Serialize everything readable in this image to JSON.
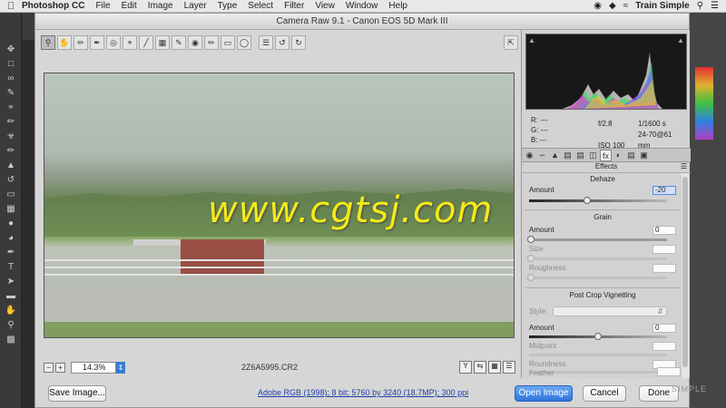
{
  "menubar": {
    "app_name": "Photoshop CC",
    "items": [
      "File",
      "Edit",
      "Image",
      "Layer",
      "Type",
      "Select",
      "Filter",
      "View",
      "Window",
      "Help"
    ],
    "user": "Train Simple"
  },
  "dialog": {
    "title": "Camera Raw 9.1  -  Canon EOS 5D Mark III",
    "zoom": "14.3%",
    "filename": "2Z6A5995.CR2",
    "workflow": "Adobe RGB (1998); 8 bit; 5760 by 3240 (18.7MP); 300 ppi",
    "buttons": {
      "save": "Save Image...",
      "open": "Open Image",
      "cancel": "Cancel",
      "done": "Done"
    }
  },
  "watermark": "www.cgtsj.com",
  "info": {
    "r": "R:   ---",
    "g": "G:   ---",
    "b": "B:   ---",
    "aperture": "f/2.8",
    "shutter": "1/1600 s",
    "iso": "ISO 100",
    "lens": "24-70@61 mm"
  },
  "panel": {
    "title": "Effects",
    "dehaze": {
      "heading": "Dehaze",
      "amount_label": "Amount",
      "amount": "-20",
      "amount_level": -20
    },
    "grain": {
      "heading": "Grain",
      "amount_label": "Amount",
      "amount": "0",
      "size_label": "Size",
      "roughness_label": "Roughness"
    },
    "vignette": {
      "heading": "Post Crop Vignetting",
      "style_label": "Style:",
      "amount_label": "Amount",
      "amount": "0",
      "midpoint_label": "Midpoint",
      "roundness_label": "Roundness",
      "feather_label": "Feather"
    }
  },
  "bg_watermark": "SIMPLE"
}
